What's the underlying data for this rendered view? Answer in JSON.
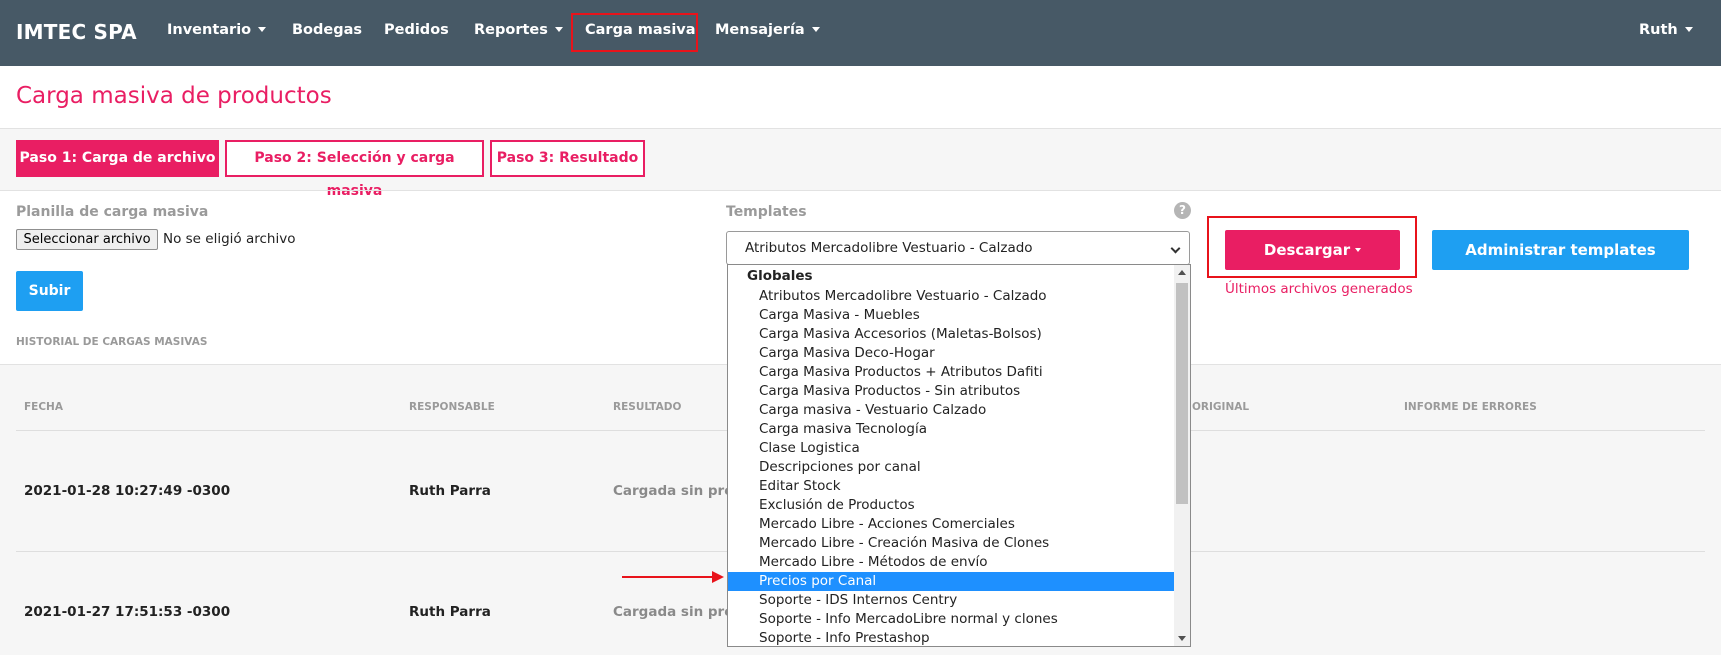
{
  "navbar": {
    "brand": "IMTEC SPA",
    "items": [
      {
        "label": "Inventario"
      },
      {
        "label": "Bodegas"
      },
      {
        "label": "Pedidos"
      },
      {
        "label": "Reportes"
      },
      {
        "label": "Carga masiva"
      },
      {
        "label": "Mensajería"
      }
    ],
    "user": "Ruth"
  },
  "page": {
    "title": "Carga masiva de productos",
    "steps": [
      {
        "label": "Paso 1: Carga de archivo",
        "active": true
      },
      {
        "label": "Paso 2: Selección y carga masiva",
        "active": false
      },
      {
        "label": "Paso 3: Resultado",
        "active": false
      }
    ]
  },
  "upload": {
    "label": "Planilla de carga masiva",
    "file_button": "Seleccionar archivo",
    "file_status": "No se eligió archivo",
    "submit": "Subir"
  },
  "templates": {
    "label": "Templates",
    "help_icon": "?",
    "selected": "Atributos Mercadolibre Vestuario - Calzado",
    "group": "Globales",
    "options": [
      "Atributos Mercadolibre Vestuario - Calzado",
      "Carga Masiva - Muebles",
      "Carga Masiva Accesorios (Maletas-Bolsos)",
      "Carga Masiva Deco-Hogar",
      "Carga Masiva Productos + Atributos Dafiti",
      "Carga Masiva Productos - Sin atributos",
      "Carga masiva - Vestuario Calzado",
      "Carga masiva Tecnología",
      "Clase Logistica",
      "Descripciones por canal",
      "Editar Stock",
      "Exclusión de Productos",
      "Mercado Libre - Acciones Comerciales",
      "Mercado Libre - Creación Masiva de Clones",
      "Mercado Libre - Métodos de envío",
      "Precios por Canal",
      "Soporte - IDS Internos Centry",
      "Soporte - Info MercadoLibre normal y clones",
      "Soporte - Info Prestashop"
    ],
    "highlighted_option": "Precios por Canal",
    "download_button": "Descargar",
    "last_files": "Últimos archivos generados",
    "admin_button": "Administrar templates"
  },
  "history": {
    "title": "HISTORIAL DE CARGAS MASIVAS",
    "columns": [
      "FECHA",
      "RESPONSABLE",
      "RESULTADO",
      "ORIGINAL",
      "INFORME DE ERRORES"
    ],
    "rows": [
      {
        "fecha": "2021-01-28 10:27:49 -0300",
        "responsable": "Ruth Parra",
        "resultado": "Cargada sin proce"
      },
      {
        "fecha": "2021-01-27 17:51:53 -0300",
        "responsable": "Ruth Parra",
        "resultado": "Cargada sin proce"
      }
    ]
  },
  "colors": {
    "navbar_bg": "#475966",
    "accent_pink": "#e91e63",
    "accent_blue": "#1e9ff2",
    "annotation_red": "#e8131b"
  }
}
